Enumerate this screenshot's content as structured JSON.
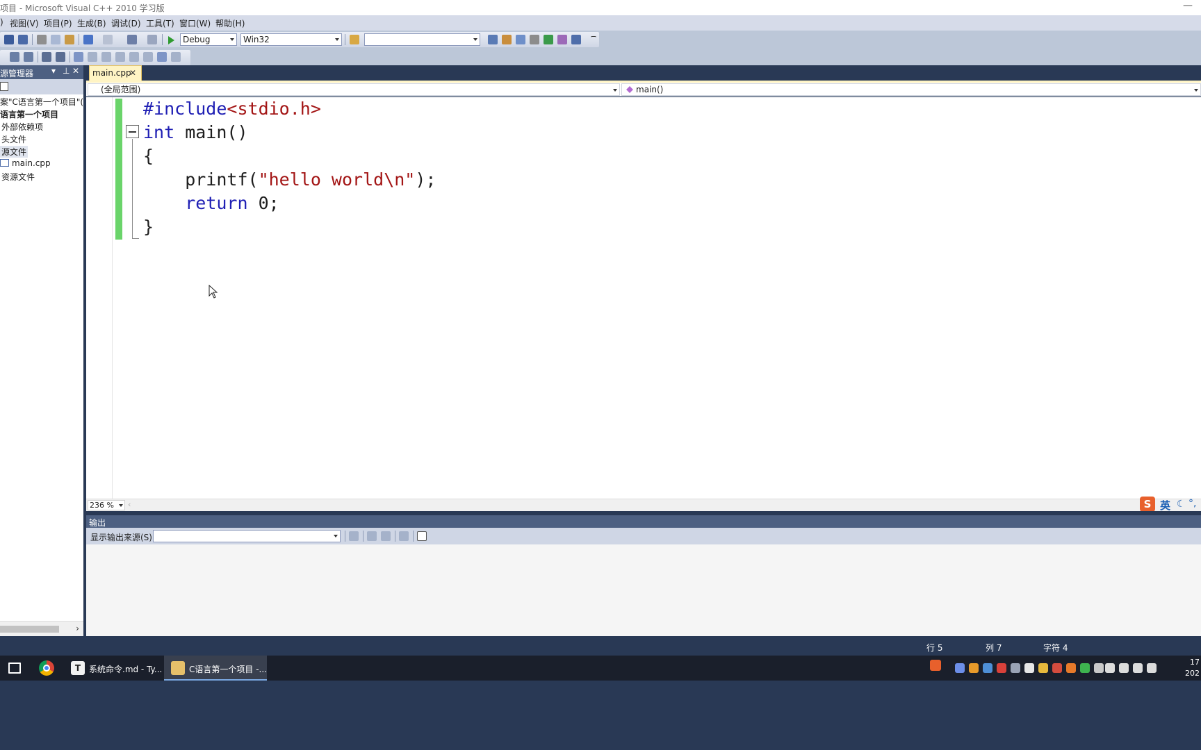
{
  "window": {
    "title": "项目 - Microsoft Visual C++ 2010 学习版"
  },
  "menu": [
    {
      "label": "视图(V)"
    },
    {
      "label": "项目(P)"
    },
    {
      "label": "生成(B)"
    },
    {
      "label": "调试(D)"
    },
    {
      "label": "工具(T)"
    },
    {
      "label": "窗口(W)"
    },
    {
      "label": "帮助(H)"
    }
  ],
  "toolbar": {
    "config": "Debug",
    "platform": "Win32",
    "find": ""
  },
  "solution_explorer": {
    "title": "源管理器",
    "items": [
      {
        "label": "案\"C语言第一个项目\"(1"
      },
      {
        "label": "语言第一个项目"
      },
      {
        "label": "外部依赖项"
      },
      {
        "label": "头文件"
      },
      {
        "label": "源文件"
      },
      {
        "label": "main.cpp"
      },
      {
        "label": "资源文件"
      }
    ]
  },
  "tabs": [
    {
      "label": "main.cpp",
      "active": true
    }
  ],
  "navbar": {
    "scope": "(全局范围)",
    "member": "main()"
  },
  "editor": {
    "lines": [
      "#include<stdio.h>",
      "int main()",
      "{",
      "    printf(\"hello world\\n\");",
      "    return 0;",
      "}"
    ],
    "zoom": "236 %"
  },
  "ime": {
    "lang": "英"
  },
  "output": {
    "title": "输出",
    "source_label": "显示输出来源(S):",
    "source_value": ""
  },
  "status": {
    "line": "行 5",
    "col": "列 7",
    "char": "字符 4"
  },
  "taskbar": {
    "items": [
      {
        "label": "系统命令.md - Ty..."
      },
      {
        "label": "C语言第一个项目 -..."
      }
    ],
    "clock_time": "17",
    "clock_date": "202"
  },
  "colors": {
    "chrome": "#293955",
    "tab_active": "#fff4c4",
    "keyword": "#1f1fb4",
    "string": "#a31515",
    "change_bar": "#6ad46a"
  }
}
